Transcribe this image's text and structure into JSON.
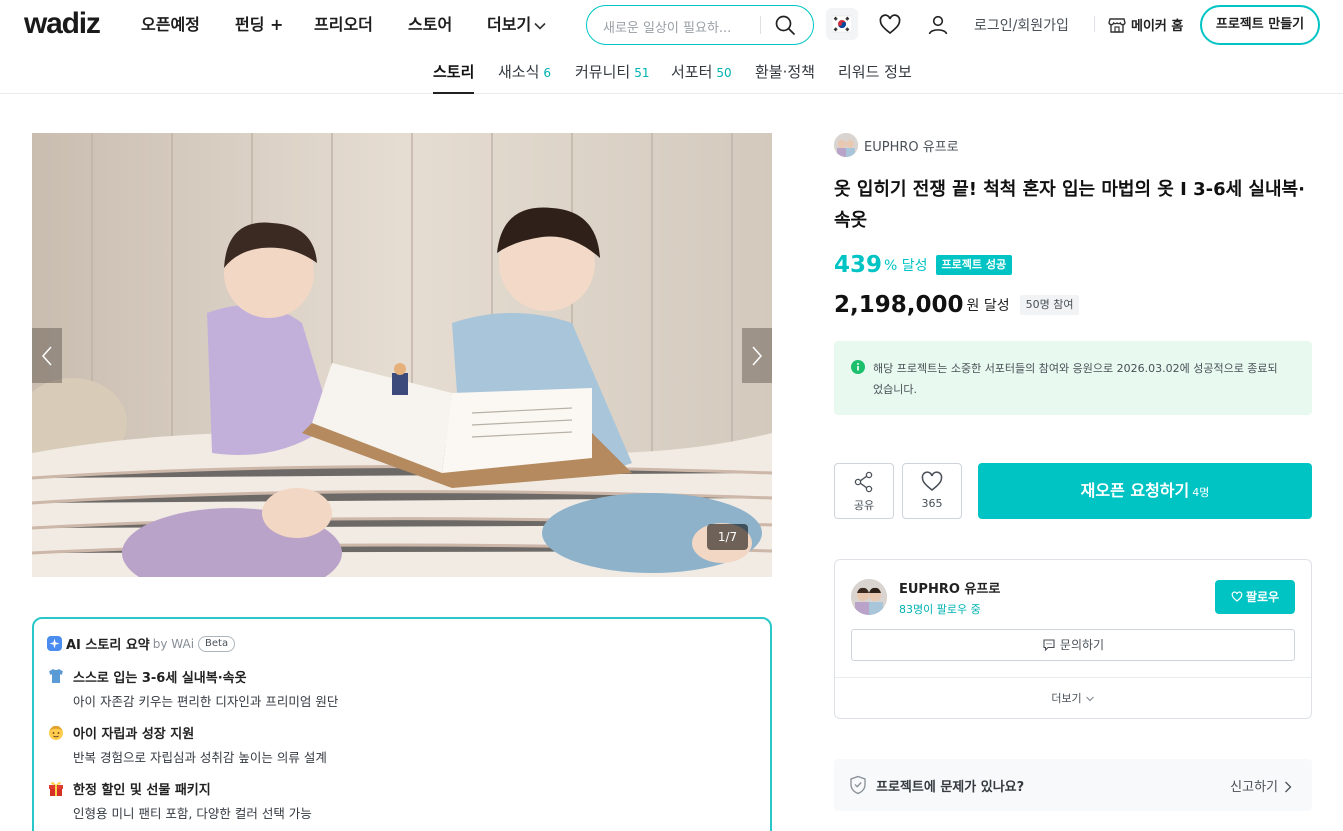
{
  "header": {
    "logo": "wadiz",
    "nav": [
      "오픈예정",
      "펀딩 +",
      "프리오더",
      "스토어",
      "더보기"
    ],
    "search_placeholder": "새로운 일상이 필요하...",
    "login": "로그인/회원가입",
    "maker_home": "메이커 홈",
    "create_project": "프로젝트 만들기"
  },
  "tabs": [
    {
      "label": "스토리",
      "count": ""
    },
    {
      "label": "새소식",
      "count": "6"
    },
    {
      "label": "커뮤니티",
      "count": "51"
    },
    {
      "label": "서포터",
      "count": "50"
    },
    {
      "label": "환불·정책",
      "count": ""
    },
    {
      "label": "리워드 정보",
      "count": ""
    }
  ],
  "gallery": {
    "pager": "1/7"
  },
  "ai_summary": {
    "title": "AI 스토리 요약",
    "by": "by WAi",
    "beta": "Beta",
    "items": [
      {
        "icon": "shirt-icon",
        "title": "스스로 입는 3-6세 실내복·속옷",
        "desc": "아이 자존감 키우는 편리한 디자인과 프리미엄 원단"
      },
      {
        "icon": "child-face-icon",
        "title": "아이 자립과 성장 지원",
        "desc": "반복 경험으로 자립심과 성취감 높이는 의류 설계"
      },
      {
        "icon": "gift-icon",
        "title": "한정 할인 및 선물 패키지",
        "desc": "인형용 미니 팬티 포함, 다양한 컬러 선택 가능"
      }
    ]
  },
  "project": {
    "maker": "EUPHRO 유프로",
    "title": "옷 입히기 전쟁 끝! 척척 혼자 입는 마법의 옷 I 3-6세 실내복·속옷",
    "percent": "439",
    "percent_unit": "% 달성",
    "success_badge": "프로젝트 성공",
    "amount": "2,198,000",
    "amount_unit": "원 달성",
    "participants": "50명 참여",
    "notice": "해당 프로젝트는 소중한 서포터들의 참여와 응원으로 2026.03.02에 성공적으로 종료되었습니다.",
    "share_label": "공유",
    "like_count": "365",
    "reopen_label": "재오픈 요청하기",
    "reopen_count": "4명"
  },
  "maker_card": {
    "name": "EUPHRO 유프로",
    "followers": "83명이 팔로우 중",
    "follow_label": "팔로우",
    "inquiry_label": "문의하기",
    "more_label": "더보기"
  },
  "report": {
    "question": "프로젝트에 문제가 있나요?",
    "link": "신고하기"
  },
  "colors": {
    "accent": "#00c4c4",
    "notice_bg": "#e8f9f0",
    "success": "#1bbf6c"
  }
}
